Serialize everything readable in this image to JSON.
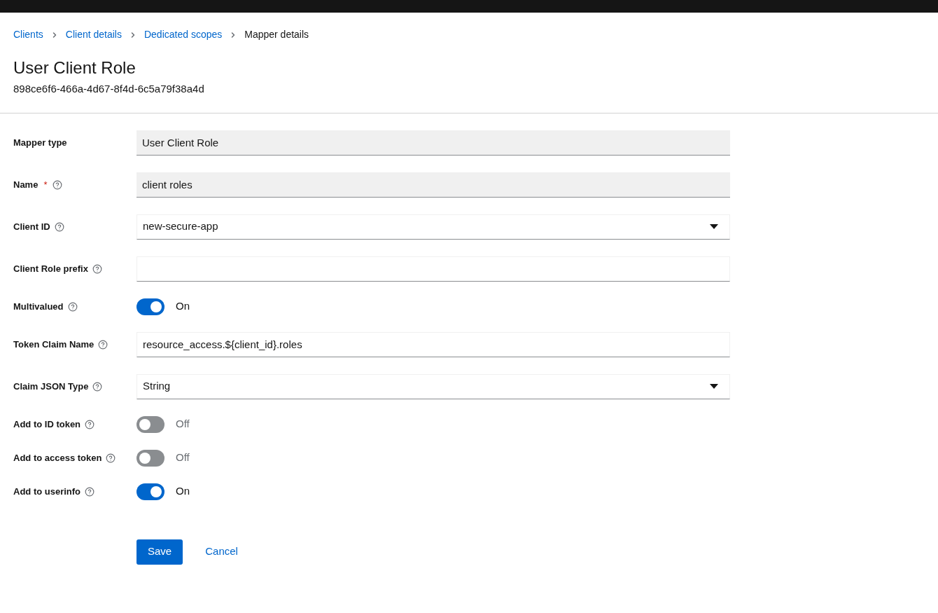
{
  "breadcrumb": [
    {
      "label": "Clients",
      "link": true
    },
    {
      "label": "Client details",
      "link": true
    },
    {
      "label": "Dedicated scopes",
      "link": true
    },
    {
      "label": "Mapper details",
      "link": false
    }
  ],
  "title": "User Client Role",
  "subtitle": "898ce6f6-466a-4d67-8f4d-6c5a79f38a4d",
  "form": [
    {
      "kind": "readonly",
      "label": "Mapper type",
      "help": false,
      "value": "User Client Role"
    },
    {
      "kind": "readonly",
      "label": "Name",
      "required_mark": "*",
      "help": true,
      "value": "client roles"
    },
    {
      "kind": "select",
      "label": "Client ID",
      "help": true,
      "value": "new-secure-app"
    },
    {
      "kind": "text",
      "label": "Client Role prefix",
      "help": true
    },
    {
      "kind": "switch",
      "label": "Multivalued",
      "help": true,
      "on": true,
      "state_text": "On"
    },
    {
      "kind": "text",
      "label": "Token Claim Name",
      "help": true,
      "value": "resource_access.${client_id}.roles"
    },
    {
      "kind": "select",
      "label": "Claim JSON Type",
      "help": true,
      "value": "String"
    },
    {
      "kind": "switch",
      "label": "Add to ID token",
      "help": true,
      "on": false,
      "state_text": "Off"
    },
    {
      "kind": "switch",
      "label": "Add to access token",
      "help": true,
      "on": false,
      "state_text": "Off"
    },
    {
      "kind": "switch",
      "label": "Add to userinfo",
      "help": true,
      "on": true,
      "state_text": "On"
    }
  ],
  "buttons": [
    {
      "kind": "primary",
      "label": "Save"
    },
    {
      "kind": "link",
      "label": "Cancel"
    }
  ]
}
